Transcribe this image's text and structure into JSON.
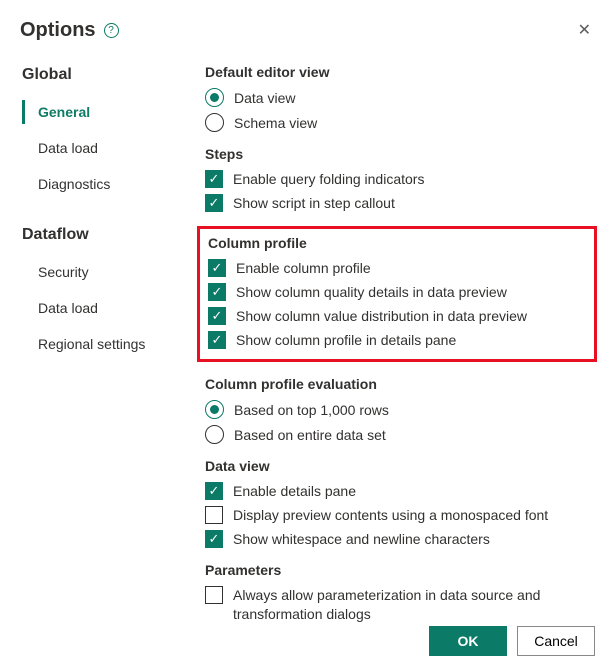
{
  "header": {
    "title": "Options"
  },
  "sidebar": {
    "groups": [
      {
        "label": "Global",
        "items": [
          {
            "label": "General",
            "active": true
          },
          {
            "label": "Data load"
          },
          {
            "label": "Diagnostics"
          }
        ]
      },
      {
        "label": "Dataflow",
        "items": [
          {
            "label": "Security"
          },
          {
            "label": "Data load"
          },
          {
            "label": "Regional settings"
          }
        ]
      }
    ]
  },
  "editor_view": {
    "title": "Default editor view",
    "data_view": "Data view",
    "schema_view": "Schema view"
  },
  "steps": {
    "title": "Steps",
    "folding": "Enable query folding indicators",
    "script": "Show script in step callout"
  },
  "column_profile": {
    "title": "Column profile",
    "enable": "Enable column profile",
    "quality": "Show column quality details in data preview",
    "distribution": "Show column value distribution in data preview",
    "details": "Show column profile in details pane"
  },
  "column_eval": {
    "title": "Column profile evaluation",
    "top": "Based on top 1,000 rows",
    "entire": "Based on entire data set"
  },
  "data_view": {
    "title": "Data view",
    "details_pane": "Enable details pane",
    "monospaced": "Display preview contents using a monospaced font",
    "whitespace": "Show whitespace and newline characters"
  },
  "parameters": {
    "title": "Parameters",
    "allow": "Always allow parameterization in data source and transformation dialogs"
  },
  "footer": {
    "ok": "OK",
    "cancel": "Cancel"
  }
}
